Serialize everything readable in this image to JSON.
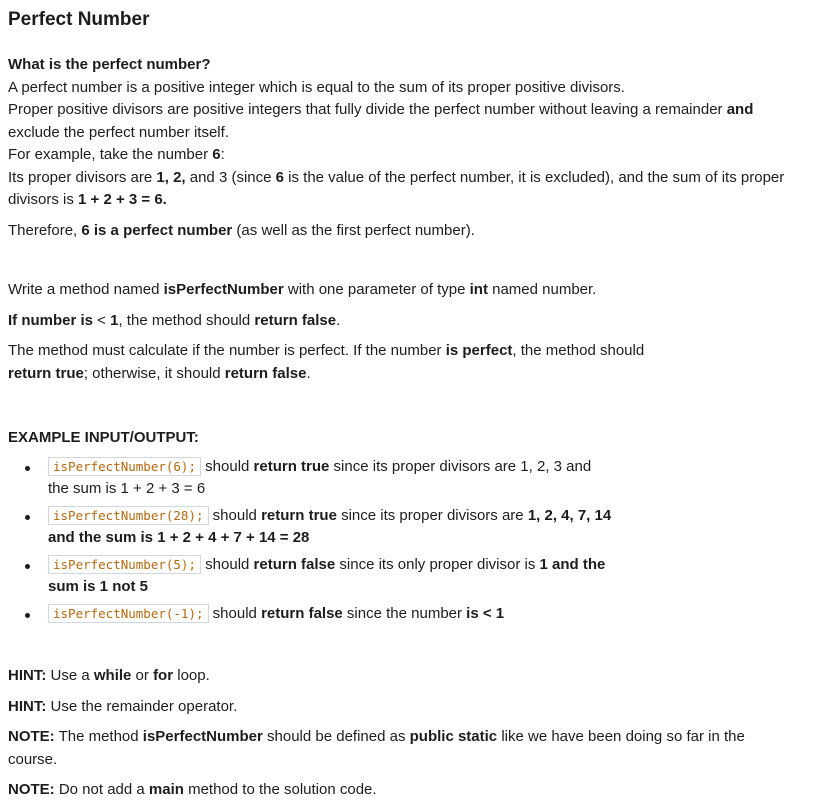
{
  "title": "Perfect Number",
  "intro": {
    "heading": "What is the perfect number?",
    "line1": "A perfect number is a positive integer which is equal to the sum of its proper positive divisors.",
    "line2a": "Proper positive divisors are positive integers that fully divide the perfect number without leaving a remainder ",
    "line2b": "and",
    "line2c": " exclude the perfect number itself.",
    "line3a": "For example, take the number ",
    "line3b": "6",
    "line3c": ":",
    "line4a": "Its proper divisors are ",
    "line4b": "1, 2,",
    "line4c": " and 3 (since ",
    "line4d": "6",
    "line4e": " is the value of the perfect number, it is excluded), and the sum of its proper divisors is ",
    "line4f": "1 + 2 + 3 = 6.",
    "line5a": "Therefore, ",
    "line5b": "6 is a perfect number",
    "line5c": " (as well as the first perfect number)."
  },
  "task": {
    "p1a": "Write a method named ",
    "p1b": "isPerfectNumber",
    "p1c": " with one parameter of type ",
    "p1d": "int",
    "p1e": " named number.",
    "p2a": "If number is",
    "p2b": " < ",
    "p2c": "1",
    "p2d": ", the method should ",
    "p2e": "return false",
    "p2f": ".",
    "p3a": "The method must calculate if the number is perfect. If the number ",
    "p3b": "is perfect",
    "p3c": ", the method should ",
    "p3d": "return true",
    "p3e": "; otherwise, it should ",
    "p3f": "return false",
    "p3g": "."
  },
  "examples": {
    "heading": "EXAMPLE INPUT/OUTPUT:",
    "items": [
      {
        "code": "isPerfectNumber(6);",
        "t1": " should ",
        "b1": "return true",
        "t2": " since its proper divisors are 1, 2, 3 and the sum is 1 + 2 + 3 = 6",
        "b2": ""
      },
      {
        "code": "isPerfectNumber(28);",
        "t1": " should ",
        "b1": "return true",
        "t2": " since its proper divisors are ",
        "b2": "1, 2, 4, 7, 14 and the sum is 1 + 2 + 4 + 7 + 14 = 28"
      },
      {
        "code": "isPerfectNumber(5);",
        "t1": " should ",
        "b1": "return false",
        "t2": " since its only proper divisor is ",
        "b2": "1 and the sum is 1 not 5"
      },
      {
        "code": "isPerfectNumber(-1);",
        "t1": " should ",
        "b1": "return false",
        "t2": " since the number ",
        "b2": "is < 1"
      }
    ]
  },
  "hints": {
    "h1a": "HINT:",
    "h1b": " Use a ",
    "h1c": "while",
    "h1d": " or ",
    "h1e": "for",
    "h1f": " loop.",
    "h2a": "HINT:",
    "h2b": " Use the remainder operator.",
    "n1a": "NOTE:",
    "n1b": " The method ",
    "n1c": "isPerfectNumber",
    "n1d": " should be defined as ",
    "n1e": "public static",
    "n1f": " like we have been doing so far in the course.",
    "n2a": "NOTE:",
    "n2b": " Do not add a ",
    "n2c": "main",
    "n2d": " method to the solution code."
  }
}
